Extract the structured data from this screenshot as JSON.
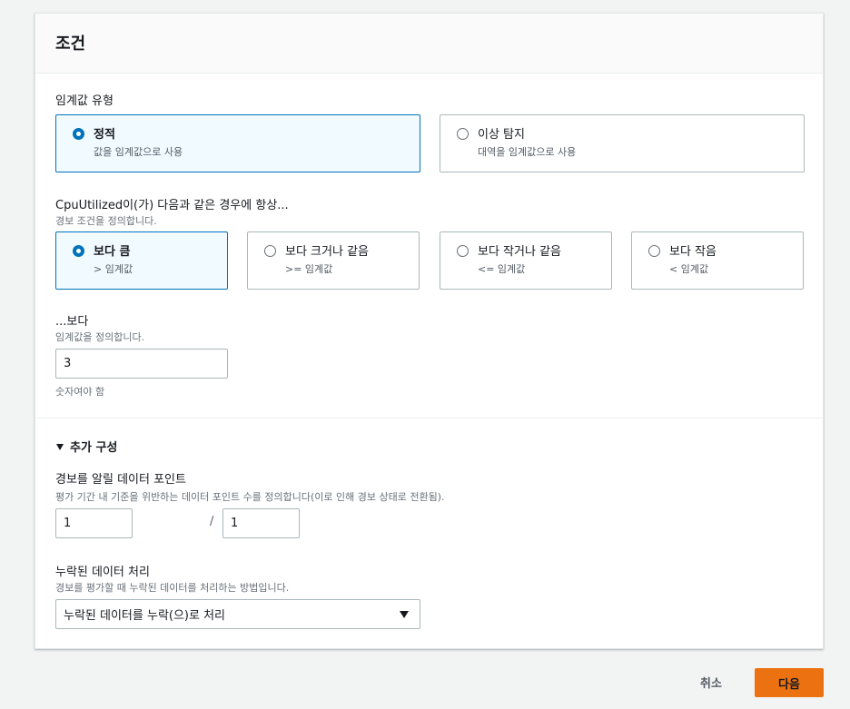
{
  "panel": {
    "title": "조건"
  },
  "threshold_type": {
    "label": "임계값 유형",
    "options": [
      {
        "title": "정적",
        "desc": "값을 임계값으로 사용",
        "selected": true
      },
      {
        "title": "이상 탐지",
        "desc": "대역을 임계값으로 사용",
        "selected": false
      }
    ]
  },
  "condition": {
    "label": "CpuUtilized이(가) 다음과 같은 경우에 항상...",
    "desc": "경보 조건을 정의합니다.",
    "options": [
      {
        "title": "보다 큼",
        "desc": "> 임계값",
        "selected": true
      },
      {
        "title": "보다 크거나 같음",
        "desc": ">= 임계값",
        "selected": false
      },
      {
        "title": "보다 작거나 같음",
        "desc": "<= 임계값",
        "selected": false
      },
      {
        "title": "보다 작음",
        "desc": "< 임계값",
        "selected": false
      }
    ]
  },
  "threshold": {
    "label": "...보다",
    "desc": "임계값을 정의합니다.",
    "value": "3",
    "hint": "숫자여야 함"
  },
  "additional": {
    "toggle_label": "추가 구성",
    "datapoints": {
      "label": "경보를 알릴 데이터 포인트",
      "desc": "평가 기간 내 기준을 위반하는 데이터 포인트 수를 정의합니다(이로 인해 경보 상태로 전환됨).",
      "value1": "1",
      "separator": "/",
      "value2": "1"
    },
    "missing_data": {
      "label": "누락된 데이터 처리",
      "desc": "경보를 평가할 때 누락된 데이터를 처리하는 방법입니다.",
      "selected": "누락된 데이터를 누락(으)로 처리"
    }
  },
  "footer": {
    "cancel_label": "취소",
    "next_label": "다음"
  },
  "colors": {
    "accent": "#0073bb",
    "primary_button": "#ec7211",
    "selected_tile_bg": "#f1faff"
  }
}
